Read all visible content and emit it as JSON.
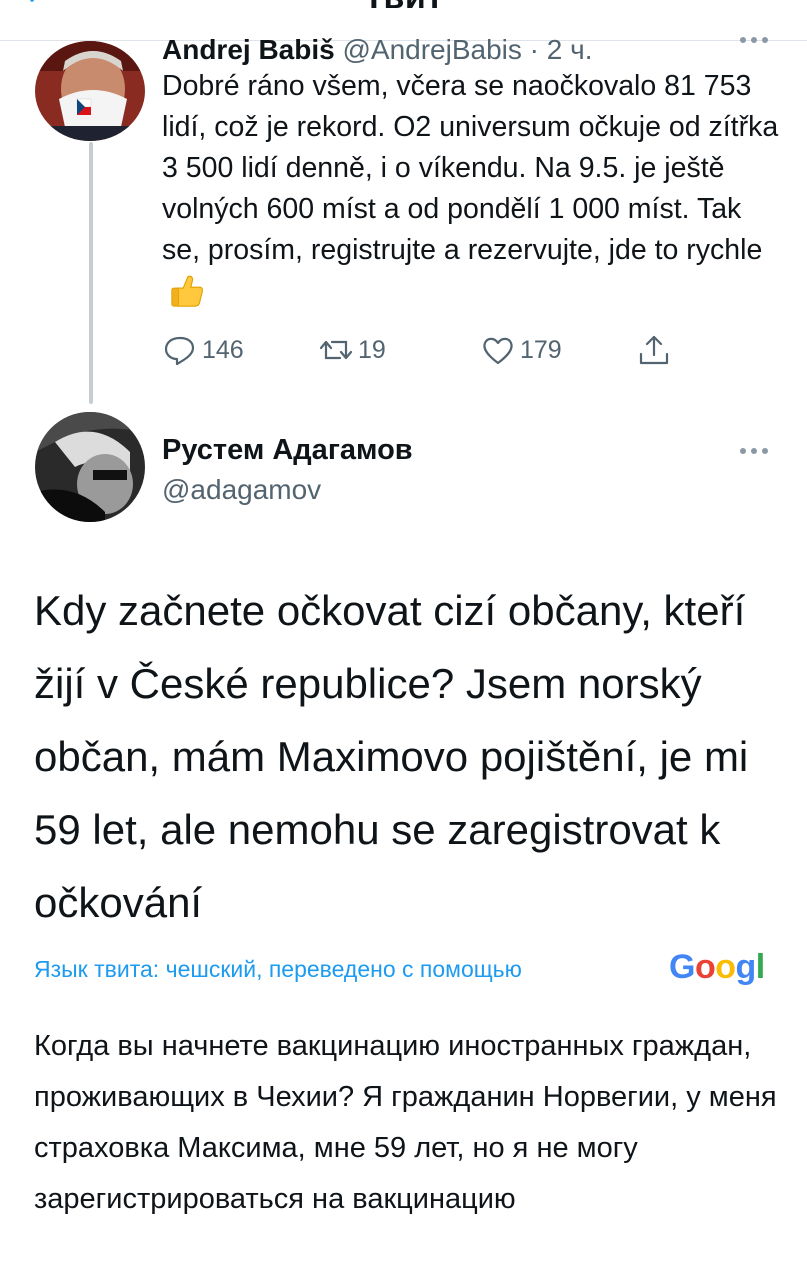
{
  "header": {
    "title": "Твит"
  },
  "parent_tweet": {
    "author_name": "Andrej Babiš",
    "author_meta": " @AndrejBabis · 2 ч.",
    "text": "Dobré ráno všem, včera se naočkovalo 81 753 lidí, což je rekord. O2 universum očkuje od zítřka 3 500 lidí denně, i o víkendu. Na 9.5. je ještě volných 600 míst a od pondělí 1 000 míst. Tak se, prosím, registrujte a rezervujte, jde to rychle",
    "emoji_icon": "thumbs-up-icon",
    "actions": {
      "replies": "146",
      "retweets": "19",
      "likes": "179"
    }
  },
  "reply_tweet": {
    "author_name": "Рустем Адагамов",
    "author_handle": "@adagamov",
    "text": "Kdy začnete očkovat cizí občany, kteří žijí v České republice? Jsem norský občan, mám Maximovo pojištění, je mi 59 let, ale nemohu se zaregistrovat k očkování",
    "translate_label": "Язык твита: чешский, переведено с помощью",
    "translation_provider": "Google",
    "translation": "Когда вы начнете вакцинацию иностранных граждан, проживающих в Чехии? Я гражданин Норвегии, у меня страховка Максима, мне 59 лет, но я не могу зарегистрироваться на вакцинацию"
  },
  "colors": {
    "link": "#1d9bf0",
    "secondary_text": "#536471",
    "thread_line": "#c5ccd3"
  }
}
